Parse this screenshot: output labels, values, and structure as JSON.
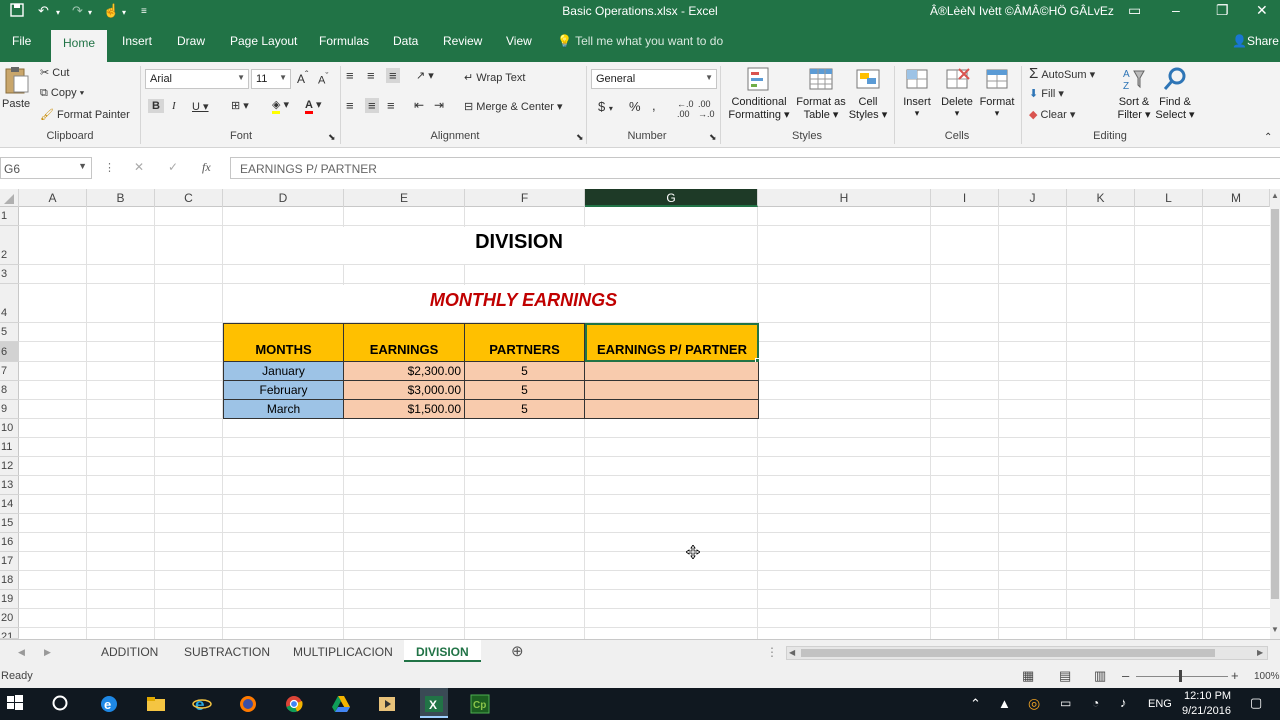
{
  "window": {
    "title": "Basic Operations.xlsx - Excel",
    "user": "Â®LèèN Ivètt ©ÂMÂ©HÖ GÂLvEz"
  },
  "ribbon_tabs": [
    "File",
    "Home",
    "Insert",
    "Draw",
    "Page Layout",
    "Formulas",
    "Data",
    "Review",
    "View"
  ],
  "tell_me": "Tell me what you want to do",
  "share": "Share",
  "clipboard": {
    "paste": "Paste",
    "cut": "Cut",
    "copy": "Copy",
    "format_painter": "Format Painter",
    "label": "Clipboard"
  },
  "font": {
    "name": "Arial",
    "size": "11",
    "label": "Font"
  },
  "alignment": {
    "wrap_text": "Wrap Text",
    "merge_center": "Merge & Center",
    "label": "Alignment"
  },
  "number": {
    "format": "General",
    "currency": "$",
    "percent": "%",
    "label": "Number"
  },
  "styles": {
    "conditional_1": "Conditional",
    "conditional_2": "Formatting",
    "format_table_1": "Format as",
    "format_table_2": "Table",
    "cell_styles_1": "Cell",
    "cell_styles_2": "Styles",
    "label": "Styles"
  },
  "cells_group": {
    "insert": "Insert",
    "delete": "Delete",
    "format": "Format",
    "label": "Cells"
  },
  "editing": {
    "autosum": "AutoSum",
    "fill": "Fill",
    "clear": "Clear",
    "sort_1": "Sort &",
    "sort_2": "Filter",
    "find_1": "Find &",
    "find_2": "Select",
    "label": "Editing"
  },
  "formula_bar": {
    "name_box": "G6",
    "fx": "fx",
    "content": "EARNINGS P/ PARTNER"
  },
  "columns": [
    "A",
    "B",
    "C",
    "D",
    "E",
    "F",
    "G",
    "H",
    "I",
    "J",
    "K",
    "L",
    "M"
  ],
  "rows": [
    "1",
    "2",
    "3",
    "4",
    "5",
    "6",
    "7",
    "8",
    "9",
    "10",
    "11",
    "12",
    "13",
    "14",
    "15",
    "16",
    "17",
    "18",
    "19",
    "20",
    "21"
  ],
  "sheet": {
    "title": "DIVISION",
    "subtitle": "MONTHLY EARNINGS",
    "headers": [
      "MONTHS",
      "EARNINGS",
      "PARTNERS",
      "EARNINGS P/ PARTNER"
    ],
    "rows": [
      {
        "month": "January",
        "earnings": "$2,300.00",
        "partners": "5",
        "per_partner": ""
      },
      {
        "month": "February",
        "earnings": "$3,000.00",
        "partners": "5",
        "per_partner": ""
      },
      {
        "month": "March",
        "earnings": "$1,500.00",
        "partners": "5",
        "per_partner": ""
      }
    ]
  },
  "sheet_tabs": [
    "ADDITION",
    "SUBTRACTION",
    "MULTIPLICACION",
    "DIVISION"
  ],
  "status": {
    "ready": "Ready",
    "zoom": "100%"
  },
  "taskbar": {
    "lang": "ENG",
    "time": "12:10 PM",
    "date": "9/21/2016"
  },
  "colors": {
    "excel_green": "#217346",
    "header_fill": "#ffc000",
    "month_fill": "#9dc3e6",
    "value_fill": "#f8cbad",
    "subtitle_red": "#c00000"
  }
}
